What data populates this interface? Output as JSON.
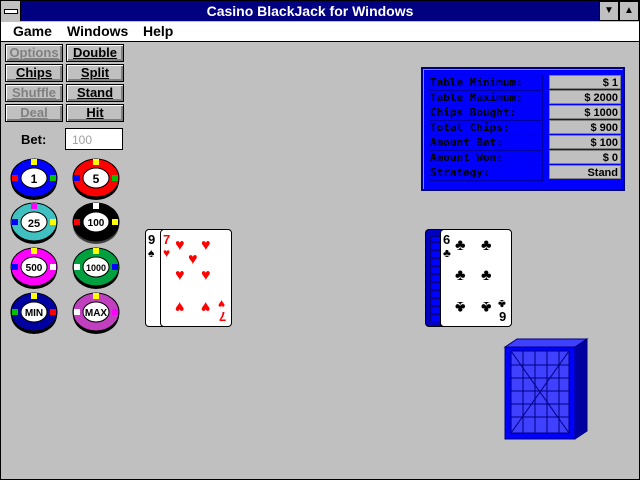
{
  "window": {
    "title": "Casino BlackJack for Windows"
  },
  "menu": {
    "items": [
      "Game",
      "Windows",
      "Help"
    ]
  },
  "buttons": {
    "options": "Options",
    "double": "Double",
    "chips": "Chips",
    "split": "Split",
    "shuffle": "Shuffle",
    "stand": "Stand",
    "deal": "Deal",
    "hit": "Hit"
  },
  "bet": {
    "label": "Bet:",
    "value": "100"
  },
  "chips": [
    {
      "label": "1",
      "color": "#0000ff"
    },
    {
      "label": "5",
      "color": "#ff0000"
    },
    {
      "label": "25",
      "color": "#40c0c0"
    },
    {
      "label": "100",
      "color": "#000000"
    },
    {
      "label": "500",
      "color": "#ff00ff"
    },
    {
      "label": "1000",
      "color": "#00a040"
    },
    {
      "label": "MIN",
      "color": "#0000a0"
    },
    {
      "label": "MAX",
      "color": "#c040c0"
    }
  ],
  "info_panel": {
    "rows": [
      {
        "label": "Table Minimum:",
        "value": "$    1"
      },
      {
        "label": "Table Maximum:",
        "value": "$ 2000"
      },
      {
        "label": "Chips Bought:",
        "value": "$ 1000"
      },
      {
        "label": "Total Chips:",
        "value": "$  900"
      },
      {
        "label": "Amount Bet:",
        "value": "$  100"
      },
      {
        "label": "Amount Won:",
        "value": "$    0"
      },
      {
        "label": "Strategy:",
        "value": "Stand"
      }
    ]
  },
  "player_hand": [
    {
      "rank": "9",
      "suit": "spade-icon"
    },
    {
      "rank": "7",
      "suit": "heart-icon"
    }
  ],
  "dealer_hand": [
    {
      "rank": "6",
      "suit": "club-icon"
    }
  ]
}
